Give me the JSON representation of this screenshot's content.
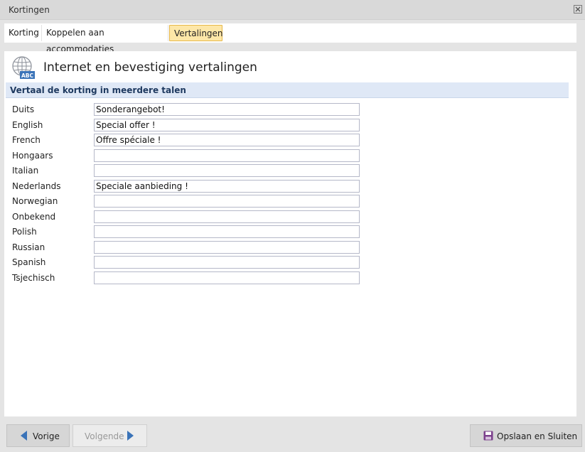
{
  "window": {
    "title": "Kortingen",
    "close_icon": "close-icon"
  },
  "tabs": [
    {
      "label": "Korting"
    },
    {
      "label": "Koppelen aan accommodaties"
    },
    {
      "label": "Vertalingen",
      "active": true
    }
  ],
  "header": {
    "title": "Internet en bevestiging vertalingen",
    "icon": "globe-abc-icon",
    "icon_text": "ABC"
  },
  "section": {
    "title": "Vertaal de korting in meerdere talen"
  },
  "languages": [
    {
      "label": "Duits",
      "value": "Sonderangebot!"
    },
    {
      "label": "English",
      "value": "Special offer !"
    },
    {
      "label": "French",
      "value": "Offre spéciale !"
    },
    {
      "label": "Hongaars",
      "value": ""
    },
    {
      "label": "Italian",
      "value": ""
    },
    {
      "label": "Nederlands",
      "value": "Speciale aanbieding !"
    },
    {
      "label": "Norwegian",
      "value": ""
    },
    {
      "label": "Onbekend",
      "value": ""
    },
    {
      "label": "Polish",
      "value": ""
    },
    {
      "label": "Russian",
      "value": ""
    },
    {
      "label": "Spanish",
      "value": ""
    },
    {
      "label": "Tsjechisch",
      "value": ""
    }
  ],
  "footer": {
    "prev_label": "Vorige",
    "next_label": "Volgende",
    "save_label": "Opslaan en Sluiten"
  },
  "colors": {
    "accent_blue": "#3a73b8",
    "tab_active_bg": "#fde7a8",
    "section_bg": "#dfe8f6",
    "save_icon": "#7b3f8c"
  }
}
